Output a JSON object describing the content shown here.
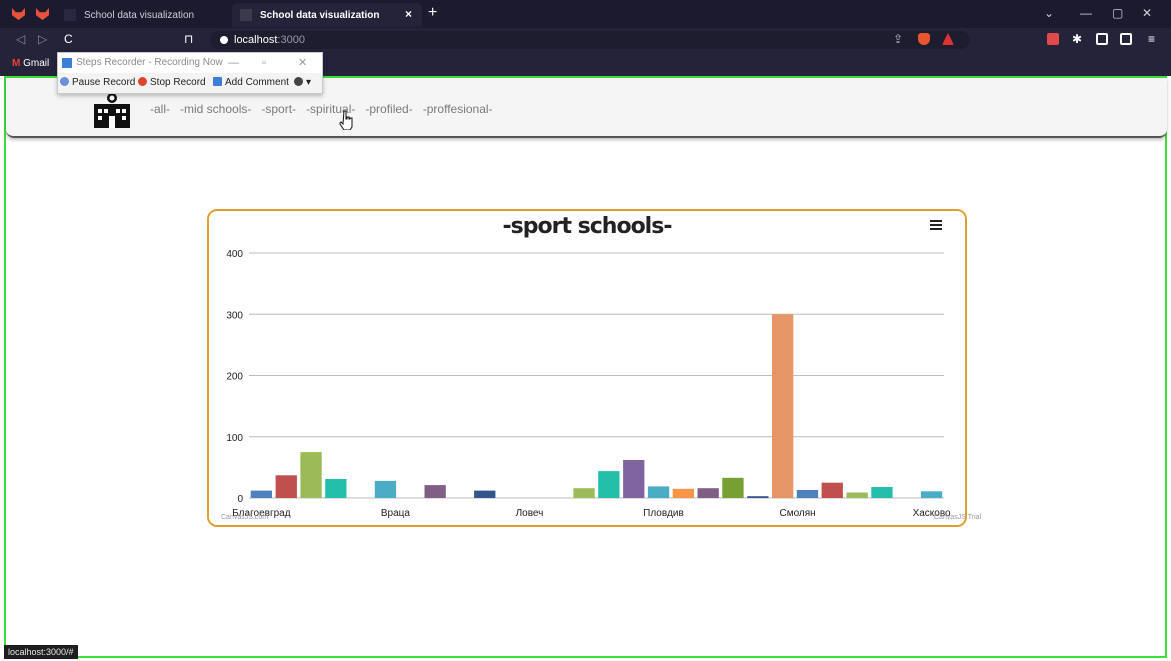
{
  "browser": {
    "tabs": [
      {
        "label": "School data visualization",
        "active": false
      },
      {
        "label": "School data visualization",
        "active": true
      }
    ],
    "url_host": "localhost",
    "url_port": ":3000",
    "bookmark": "Gmail",
    "new_tab": "+",
    "tab_close": "×"
  },
  "steps_recorder": {
    "title": "Steps Recorder - Recording Now",
    "pause": "Pause Record",
    "stop": "Stop Record",
    "comment": "Add Comment"
  },
  "nav": {
    "links": [
      "-all-",
      "-mid schools-",
      "-sport-",
      "-spiritual-",
      "-profiled-",
      "-proffesional-"
    ]
  },
  "chart_data": {
    "type": "bar",
    "title": "-sport schools-",
    "ylim": [
      0,
      400
    ],
    "yticks": [
      0,
      100,
      200,
      300,
      400
    ],
    "category_labels": [
      "Благоевград",
      "Враца",
      "Ловеч",
      "Пловдив",
      "Смолян",
      "Хасково"
    ],
    "values": [
      12,
      37,
      75,
      31,
      0,
      28,
      0,
      21,
      0,
      12,
      0,
      0,
      0,
      16,
      44,
      62,
      19,
      15,
      16,
      33,
      3,
      300,
      13,
      25,
      9,
      18,
      0,
      11
    ],
    "colors": [
      "#4f81bc",
      "#c0504e",
      "#9bbb58",
      "#23bfaa",
      "#8064a1",
      "#4aacc5",
      "#f79647",
      "#7f6084",
      "#77a033",
      "#33558b",
      "#e59566",
      "#e16e6e",
      "#a8c86e",
      "#9bbb58",
      "#23bfaa",
      "#8064a1",
      "#4aacc5",
      "#f79647",
      "#7f6084",
      "#77a033",
      "#33558b",
      "#e59566",
      "#4f81bc",
      "#c0504e",
      "#9bbb58",
      "#23bfaa",
      "#8064a1",
      "#4aacc5"
    ],
    "grid": true
  },
  "credits": {
    "left": "CanvasJS.com",
    "right": "CanvasJS Trial"
  },
  "status_bar": "localhost:3000/#",
  "colors": {
    "frame": "#3be03b",
    "card_border": "#e0a030"
  }
}
